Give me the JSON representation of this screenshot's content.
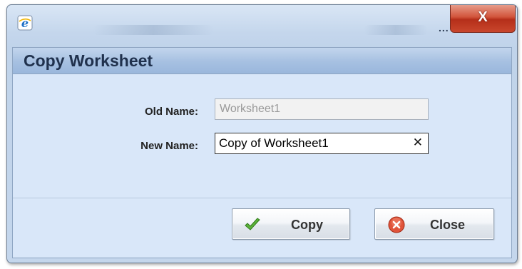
{
  "window": {
    "close_glyph": "X",
    "overflow_glyph": "..."
  },
  "dialog": {
    "title": "Copy Worksheet"
  },
  "form": {
    "old_name_label": "Old Name:",
    "old_name_value": "Worksheet1",
    "new_name_label": "New Name:",
    "new_name_value": "Copy of Worksheet1",
    "clear_glyph": "✕"
  },
  "buttons": {
    "copy_label": "Copy",
    "close_label": "Close"
  },
  "icons": {
    "browser": "internet-explorer-icon",
    "copy": "checkmark-icon",
    "close": "red-circle-x-icon"
  },
  "colors": {
    "title_close_button": "#c9462c",
    "header": "#a6c0e1",
    "panel": "#d9e7f9",
    "checkmark": "#4a9a2a",
    "close_icon": "#d8452b"
  }
}
